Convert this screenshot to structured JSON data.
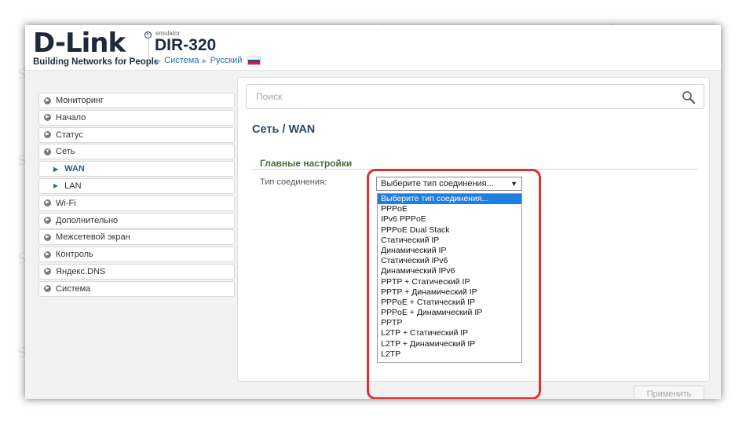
{
  "header": {
    "logo": "D-Link",
    "logo_reg": "R",
    "tagline": "Building Networks for People",
    "emulator": "emulator",
    "model": "DIR-320",
    "crumbs": [
      "Система",
      "Русский"
    ]
  },
  "sidebar": {
    "items": [
      {
        "label": "Мониторинг",
        "icon": "plus-circle-icon"
      },
      {
        "label": "Начало",
        "icon": "plus-circle-icon"
      },
      {
        "label": "Статус",
        "icon": "plus-circle-icon"
      },
      {
        "label": "Сеть",
        "icon": "minus-circle-icon"
      },
      {
        "label": "WAN",
        "icon": "triangle-right-icon"
      },
      {
        "label": "LAN",
        "icon": "triangle-right-icon"
      },
      {
        "label": "Wi-Fi",
        "icon": "plus-circle-icon"
      },
      {
        "label": "Дополнительно",
        "icon": "plus-circle-icon"
      },
      {
        "label": "Межсетевой экран",
        "icon": "plus-circle-icon"
      },
      {
        "label": "Контроль",
        "icon": "plus-circle-icon"
      },
      {
        "label": "Яндекс.DNS",
        "icon": "plus-circle-icon"
      },
      {
        "label": "Система",
        "icon": "plus-circle-icon"
      }
    ]
  },
  "search": {
    "placeholder": "Поиск",
    "icon": "magnifier-icon"
  },
  "page": {
    "title": "Сеть /  WAN"
  },
  "section": {
    "title": "Главные настройки"
  },
  "connection": {
    "label": "Тип соединения:",
    "selected": "Выберите тип соединения...",
    "options": [
      "Выберите тип соединения...",
      "PPPoE",
      "IPv6 PPPoE",
      "PPPoE Dual Stack",
      "Статический IP",
      "Динамический IP",
      "Статический IPv6",
      "Динамический IPv6",
      "PPTP + Статический IP",
      "PPTP + Динамический IP",
      "PPPoE + Статический IP",
      "PPPoE + Динамический IP",
      "PPTP",
      "L2TP + Статический IP",
      "L2TP + Динамический IP",
      "L2TP"
    ]
  },
  "apply_label": "Применить",
  "watermark": "Sovingparepair.Com",
  "colors": {
    "accent": "#1e7fe0",
    "highlight": "#e03131",
    "active_nav": "#2b5a86",
    "section": "#4b6b3c"
  }
}
